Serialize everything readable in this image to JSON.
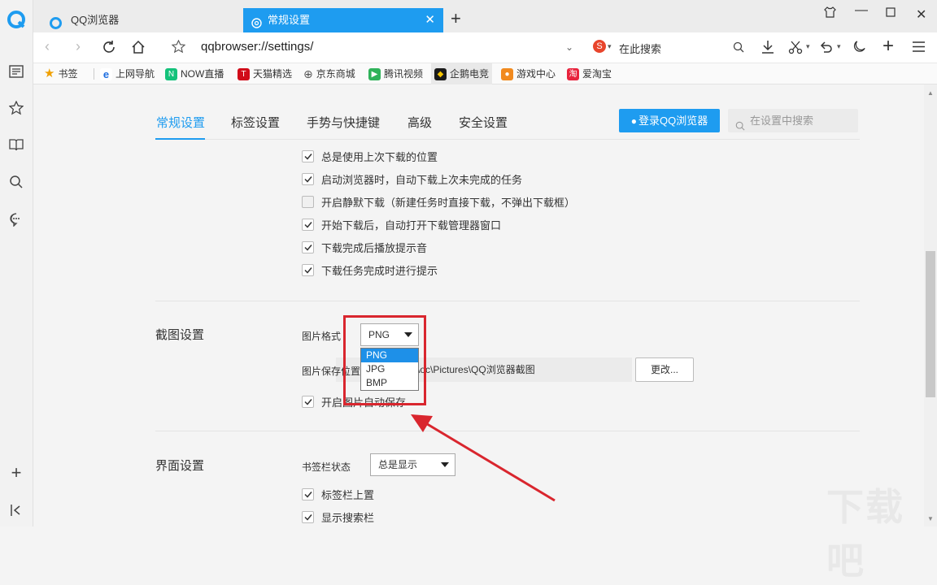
{
  "tabs": [
    {
      "label": "QQ浏览器"
    },
    {
      "label": "常规设置"
    }
  ],
  "address": {
    "url": "qqbrowser://settings/",
    "search_placeholder": "在此搜索"
  },
  "bookmarks": [
    {
      "label": "书签"
    },
    {
      "label": "上网导航"
    },
    {
      "label": "NOW直播"
    },
    {
      "label": "天猫精选"
    },
    {
      "label": "京东商城"
    },
    {
      "label": "腾讯视频"
    },
    {
      "label": "企鹅电竞"
    },
    {
      "label": "游戏中心"
    },
    {
      "label": "爱淘宝"
    }
  ],
  "settings_tabs": [
    "常规设置",
    "标签设置",
    "手势与快捷键",
    "高级",
    "安全设置"
  ],
  "login_button": "登录QQ浏览器",
  "settings_search_placeholder": "在设置中搜索",
  "download_options": [
    {
      "label": "总是使用上次下载的位置",
      "checked": true
    },
    {
      "label": "启动浏览器时，自动下载上次未完成的任务",
      "checked": true
    },
    {
      "label": "开启静默下载（新建任务时直接下载，不弹出下载框）",
      "checked": false
    },
    {
      "label": "开始下载后，自动打开下载管理器窗口",
      "checked": true
    },
    {
      "label": "下载完成后播放提示音",
      "checked": true
    },
    {
      "label": "下载任务完成时进行提示",
      "checked": true
    }
  ],
  "screenshot": {
    "title": "截图设置",
    "format_label": "图片格式",
    "format_value": "PNG",
    "format_options": [
      "PNG",
      "JPG",
      "BMP"
    ],
    "path_label": "图片保存位置",
    "path_value": "\\oc\\Pictures\\QQ浏览器截图",
    "change_button": "更改...",
    "auto_save_label": "开启图片自动保存",
    "auto_save_checked": true
  },
  "interface": {
    "title": "界面设置",
    "bookmark_bar_label": "书签栏状态",
    "bookmark_bar_value": "总是显示",
    "options": [
      {
        "label": "标签栏上置",
        "checked": true
      },
      {
        "label": "显示搜索栏",
        "checked": true
      }
    ]
  },
  "colors": {
    "accent": "#1e9cf0",
    "highlight": "#d9262e"
  },
  "watermark": "下载吧"
}
